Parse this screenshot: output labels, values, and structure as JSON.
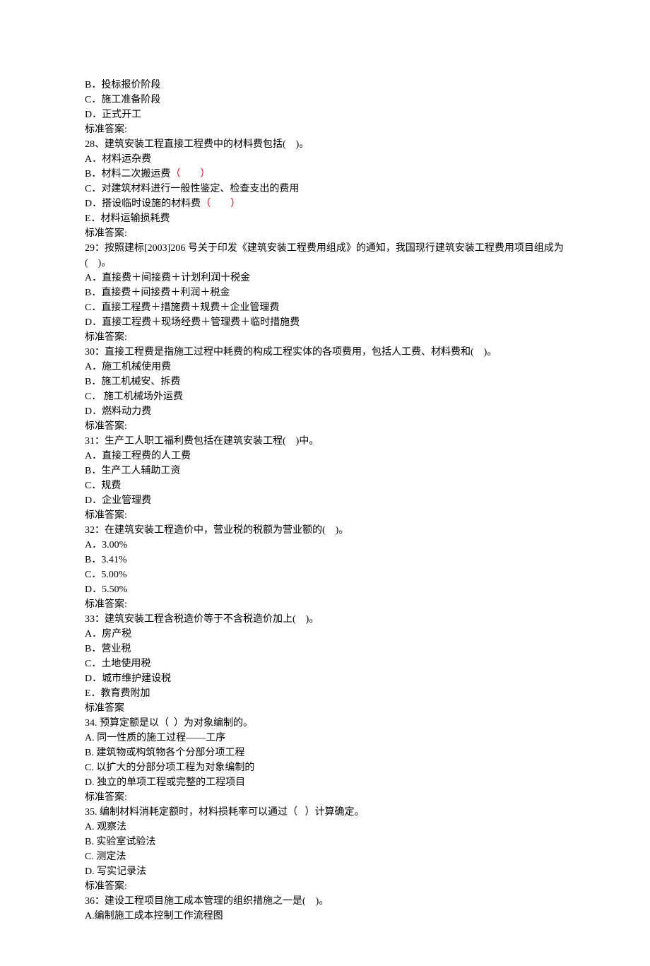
{
  "lines": [
    {
      "text": "B．投标报价阶段"
    },
    {
      "text": "C．施工准备阶段"
    },
    {
      "text": "D．正式开工"
    },
    {
      "text": "标准答案:"
    },
    {
      "text": "28、建筑安装工程直接工程费中的材料费包括(    )。"
    },
    {
      "text": "A．材料运杂费"
    },
    {
      "segments": [
        {
          "text": "B．材料二次搬运费",
          "red": false
        },
        {
          "text": "（        ）",
          "red": true
        }
      ]
    },
    {
      "text": "C．对建筑材料进行一般性鉴定、检查支出的费用"
    },
    {
      "segments": [
        {
          "text": "D．搭设临时设施的材料费",
          "red": false
        },
        {
          "text": "（        ）",
          "red": true
        }
      ]
    },
    {
      "text": "E．材料运输损耗费"
    },
    {
      "text": "标准答案:"
    },
    {
      "text": "29：按照建标[2003]206 号关于印发《建筑安装工程费用组成》的通知，我国现行建筑安装工程费用项目组成为(    )。"
    },
    {
      "text": "A．直接费＋间接费＋计划利润十税金"
    },
    {
      "text": "B．直接费＋间接费＋利润＋税金"
    },
    {
      "text": "C．直接工程费＋措施费＋规费＋企业管理费"
    },
    {
      "text": "D．直接工程费＋现场经费＋管理费＋临时措施费"
    },
    {
      "text": "标准答案:"
    },
    {
      "text": "30：直接工程费是指施工过程中耗费的构成工程实体的各项费用，包括人工费、材料费和(    )。"
    },
    {
      "text": "A．施工机械使用费"
    },
    {
      "text": "B．施工机械安、拆费"
    },
    {
      "text": "C． 施工机械场外运费"
    },
    {
      "text": "D．燃料动力费"
    },
    {
      "text": "标准答案:"
    },
    {
      "text": "31：生产工人职工福利费包括在建筑安装工程(    )中。"
    },
    {
      "text": "A．直接工程费的人工费"
    },
    {
      "text": "B．生产工人辅助工资"
    },
    {
      "text": "C．规费"
    },
    {
      "text": "D．企业管理费"
    },
    {
      "text": "标准答案:"
    },
    {
      "text": "32：在建筑安装工程造价中，营业税的税额为营业额的(    )。"
    },
    {
      "text": "A．3.00%"
    },
    {
      "text": "B．3.41%"
    },
    {
      "text": "C．5.00%"
    },
    {
      "text": "D．5.50%"
    },
    {
      "text": "标准答案:"
    },
    {
      "text": "33：建筑安装工程含税造价等于不含税造价加上(    )。"
    },
    {
      "text": "A．房产税"
    },
    {
      "text": "B．营业税"
    },
    {
      "text": "C．土地使用税"
    },
    {
      "text": "D．城市维护建设税"
    },
    {
      "text": "E．教育费附加"
    },
    {
      "text": "标准答案"
    },
    {
      "text": "34. 预算定额是以（  ）为对象编制的。"
    },
    {
      "text": "A. 同一性质的施工过程——工序"
    },
    {
      "text": "B. 建筑物或构筑物各个分部分项工程"
    },
    {
      "text": "C. 以扩大的分部分项工程为对象编制的"
    },
    {
      "text": "D. 独立的单项工程或完整的工程项目"
    },
    {
      "text": "标准答案:"
    },
    {
      "text": "35. 编制材料消耗定额时，材料损耗率可以通过（   ）计算确定。"
    },
    {
      "text": "A. 观察法"
    },
    {
      "text": "B. 实验室试验法"
    },
    {
      "text": "C. 测定法"
    },
    {
      "text": "D. 写实记录法"
    },
    {
      "text": "标准答案:"
    },
    {
      "text": "36：建设工程项目施工成本管理的组织措施之一是(    )。"
    },
    {
      "text": "A.编制施工成本控制工作流程图"
    }
  ]
}
